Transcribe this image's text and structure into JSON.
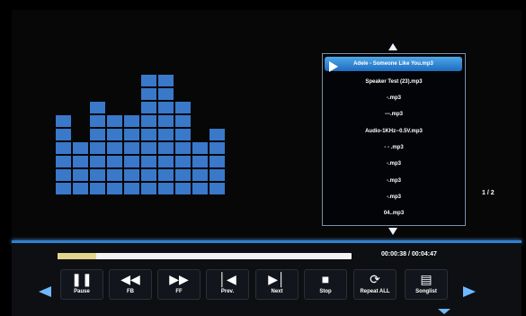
{
  "playlist": {
    "items": [
      "Adele - Someone Like You.mp3",
      "Speaker Test (23).mp3",
      "-.mp3",
      "---.mp3",
      "Audio-1KHz--0.5V.mp3",
      "- - .mp3",
      "-.mp3",
      "-.mp3",
      "-.mp3",
      "04..mp3"
    ],
    "selected_index": 0,
    "page_indicator": "1 / 2"
  },
  "equalizer": {
    "bar_levels": [
      6,
      4,
      7,
      6,
      6,
      9,
      9,
      7,
      4,
      5
    ],
    "color": "#3a78c9"
  },
  "playback": {
    "time_display": "00:00:38  /  00:04:47",
    "progress_fraction": 0.13
  },
  "controls": [
    {
      "id": "pause",
      "label": "Pause",
      "icon": "pause-icon"
    },
    {
      "id": "fb",
      "label": "FB",
      "icon": "fast-backward-icon"
    },
    {
      "id": "ff",
      "label": "FF",
      "icon": "fast-forward-icon"
    },
    {
      "id": "prev",
      "label": "Prev.",
      "icon": "previous-icon"
    },
    {
      "id": "next",
      "label": "Next",
      "icon": "next-icon"
    },
    {
      "id": "stop",
      "label": "Stop",
      "icon": "stop-icon"
    },
    {
      "id": "repeat",
      "label": "Repeat ALL",
      "icon": "repeat-icon"
    },
    {
      "id": "songlist",
      "label": "Songlist",
      "icon": "songlist-icon"
    }
  ]
}
